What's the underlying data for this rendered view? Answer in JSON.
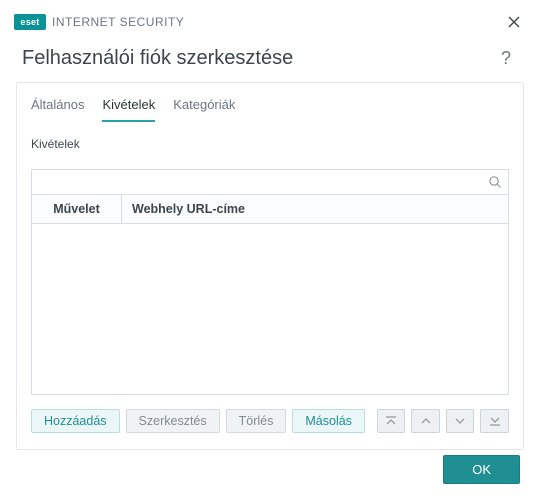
{
  "brand": {
    "badge": "eset",
    "name": "INTERNET SECURITY"
  },
  "header": {
    "title": "Felhasználói fiók szerkesztése",
    "help": "?"
  },
  "tabs": [
    {
      "label": "Általános",
      "active": false
    },
    {
      "label": "Kivételek",
      "active": true
    },
    {
      "label": "Kategóriák",
      "active": false
    }
  ],
  "section": {
    "label": "Kivételek"
  },
  "table": {
    "columns": {
      "action": "Művelet",
      "url": "Webhely URL-címe"
    },
    "rows": []
  },
  "buttons": {
    "add": "Hozzáadás",
    "edit": "Szerkesztés",
    "delete": "Törlés",
    "copy": "Másolás"
  },
  "footer": {
    "ok": "OK"
  }
}
